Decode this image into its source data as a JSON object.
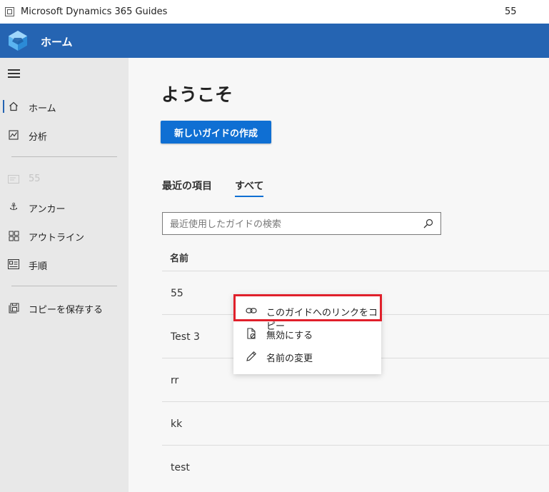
{
  "titlebar": {
    "app_title": "Microsoft Dynamics 365 Guides",
    "document": "55"
  },
  "appbar": {
    "title": "ホーム"
  },
  "sidebar": {
    "items": [
      {
        "label": "ホーム",
        "icon": "home-icon"
      },
      {
        "label": "分析",
        "icon": "analytics-icon"
      },
      {
        "label": "55",
        "icon": "guide-icon"
      },
      {
        "label": "アンカー",
        "icon": "anchor-icon"
      },
      {
        "label": "アウトライン",
        "icon": "outline-icon"
      },
      {
        "label": "手順",
        "icon": "steps-icon"
      },
      {
        "label": "コピーを保存する",
        "icon": "save-copy-icon"
      }
    ]
  },
  "main": {
    "welcome": "ようこそ",
    "new_guide_button": "新しいガイドの作成",
    "tabs": [
      {
        "label": "最近の項目"
      },
      {
        "label": "すべて"
      }
    ],
    "search": {
      "placeholder": "最近使用したガイドの検索",
      "value": ""
    },
    "table": {
      "column_header": "名前",
      "rows": [
        {
          "name": "55"
        },
        {
          "name": "Test 3"
        },
        {
          "name": "rr"
        },
        {
          "name": "kk"
        },
        {
          "name": "test"
        }
      ]
    }
  },
  "context_menu": {
    "items": [
      {
        "label": "このガイドへのリンクをコピー",
        "icon": "link-icon"
      },
      {
        "label": "無効にする",
        "icon": "disable-document-icon"
      },
      {
        "label": "名前の変更",
        "icon": "rename-pencil-icon"
      }
    ]
  },
  "colors": {
    "appbar": "#2564b2",
    "accent": "#0f6fd3",
    "highlight": "#e0202b",
    "sidebar": "#e8e8e8"
  }
}
